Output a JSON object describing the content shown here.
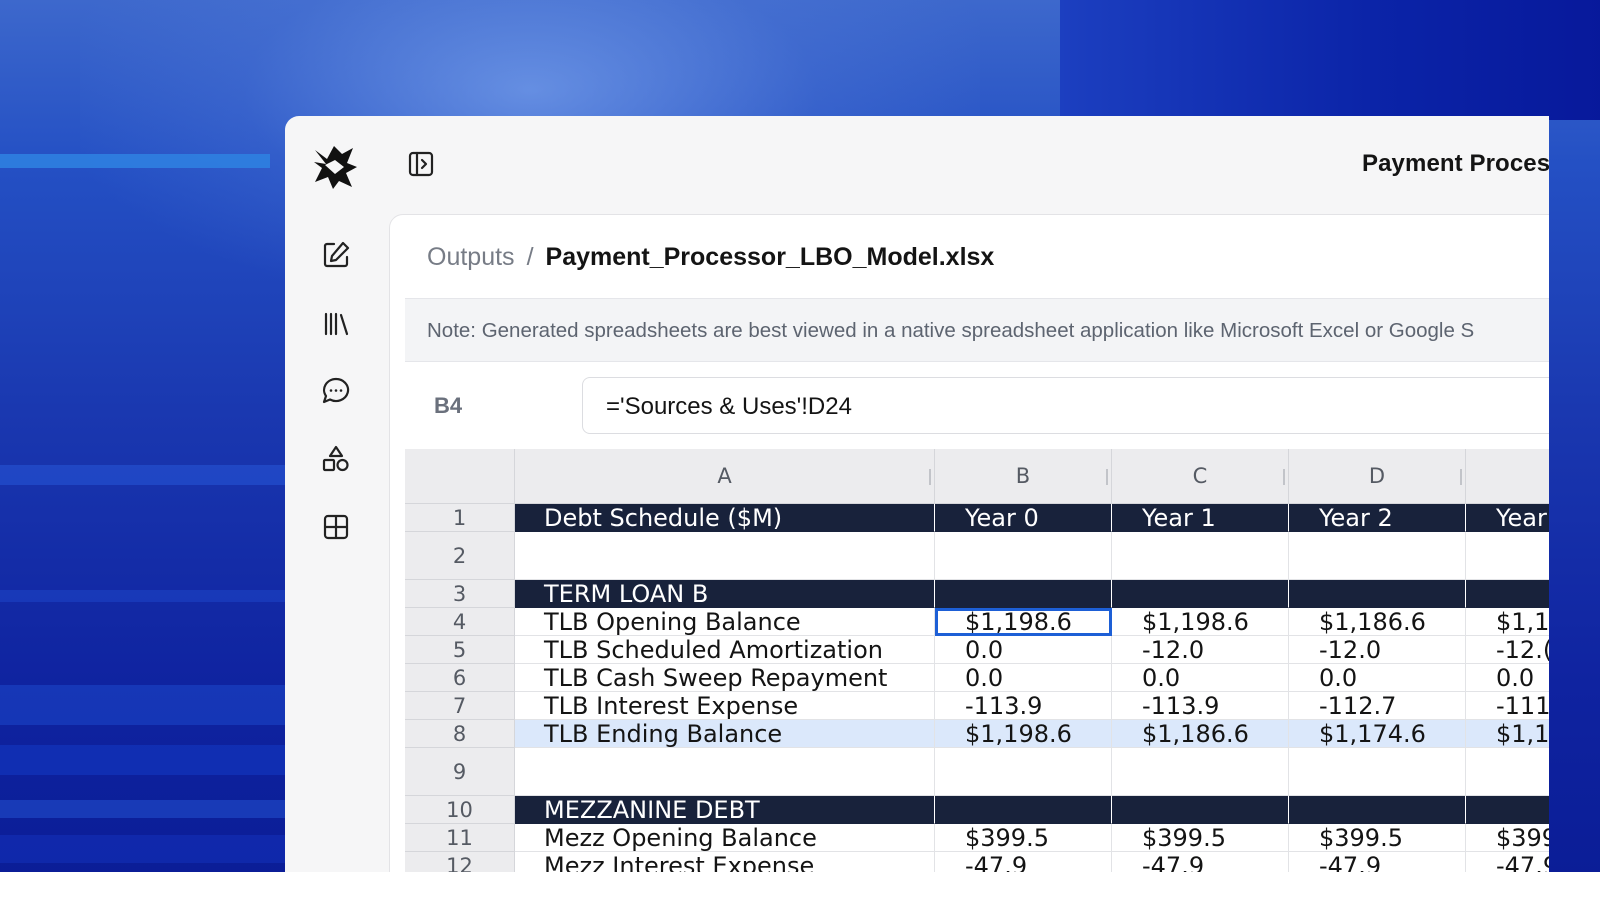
{
  "colors": {
    "header_fill": "#18223b",
    "highlight_row": "#dbe8fb",
    "selection_border": "#1d5fd6",
    "background_blue": "#1a38b0"
  },
  "topbar": {
    "title": "Payment Proces"
  },
  "sidebar": {
    "logo_icon": "logo-icon",
    "toggle_icon": "sidebar-toggle-icon",
    "items": [
      {
        "icon": "edit-icon"
      },
      {
        "icon": "library-icon"
      },
      {
        "icon": "chat-icon"
      },
      {
        "icon": "shapes-icon"
      },
      {
        "icon": "grid-icon"
      }
    ]
  },
  "breadcrumb": {
    "root": "Outputs",
    "separator": "/",
    "file": "Payment_Processor_LBO_Model.xlsx"
  },
  "note": "Note: Generated spreadsheets are best viewed in a native spreadsheet application like Microsoft Excel or Google S",
  "formula_bar": {
    "cell_ref": "B4",
    "formula": "='Sources & Uses'!D24"
  },
  "sheet": {
    "columns": [
      "A",
      "B",
      "C",
      "D",
      ""
    ],
    "selected_cell": "B4",
    "rows": [
      {
        "num": "1",
        "cells": [
          "Debt Schedule ($M)",
          "Year 0",
          "Year 1",
          "Year 2",
          "Year"
        ]
      },
      {
        "num": "2",
        "cells": [
          "",
          "",
          "",
          "",
          ""
        ]
      },
      {
        "num": "3",
        "cells": [
          "TERM LOAN B",
          "",
          "",
          "",
          ""
        ]
      },
      {
        "num": "4",
        "cells": [
          "TLB Opening Balance",
          "$1,198.6",
          "$1,198.6",
          "$1,186.6",
          "$1,1"
        ]
      },
      {
        "num": "5",
        "cells": [
          "TLB Scheduled Amortization",
          "0.0",
          "-12.0",
          "-12.0",
          "-12.("
        ]
      },
      {
        "num": "6",
        "cells": [
          "TLB Cash Sweep Repayment",
          "0.0",
          "0.0",
          "0.0",
          "0.0"
        ]
      },
      {
        "num": "7",
        "cells": [
          "TLB Interest Expense",
          "-113.9",
          "-113.9",
          "-112.7",
          "-111"
        ]
      },
      {
        "num": "8",
        "cells": [
          "TLB Ending Balance",
          "$1,198.6",
          "$1,186.6",
          "$1,174.6",
          "$1,1"
        ]
      },
      {
        "num": "9",
        "cells": [
          "",
          "",
          "",
          "",
          ""
        ]
      },
      {
        "num": "10",
        "cells": [
          "MEZZANINE DEBT",
          "",
          "",
          "",
          ""
        ]
      },
      {
        "num": "11",
        "cells": [
          "Mezz Opening Balance",
          "$399.5",
          "$399.5",
          "$399.5",
          "$399"
        ]
      },
      {
        "num": "12",
        "cells": [
          "Mezz Interest Expense",
          "-47.9",
          "-47.9",
          "-47.9",
          "-47.9"
        ]
      }
    ]
  }
}
